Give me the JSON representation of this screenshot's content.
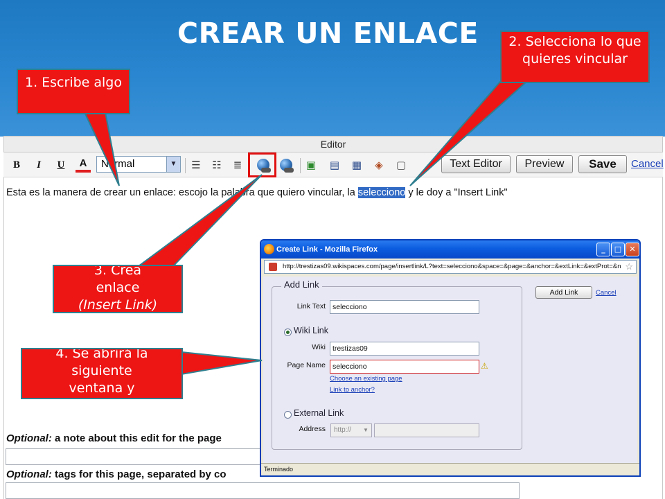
{
  "slide": {
    "title": "CREAR UN ENLACE"
  },
  "callouts": {
    "c1": "1. Escribe algo",
    "c2": "2. Selecciona lo que quieres vincular",
    "c3_line1": "3. Crea",
    "c3_line2": "enlace",
    "c3_line3": "(Insert Link)",
    "c4_line1": "4. Se abrirá la",
    "c4_line2": "siguiente",
    "c4_line3": "ventana y"
  },
  "editor": {
    "title": "Editor",
    "bold_label": "B",
    "italic_label": "I",
    "underline_label": "U",
    "color_label": "A",
    "format_value": "Normal",
    "text_editor_label": "Text Editor",
    "preview_label": "Preview",
    "save_label": "Save",
    "cancel_label": "Cancel",
    "body_before": "Esta es la manera de crear un enlace: escojo la palabra que quiero vincular, la ",
    "body_selected": "selecciono",
    "body_after": " y le doy a \"Insert Link\"",
    "optional_1_em": "Optional:",
    "optional_1_rest": " a note about this edit for the page",
    "optional_2_em": "Optional:",
    "optional_2_rest": " tags for this page, separated by co"
  },
  "popup": {
    "window_title": "Create Link - Mozilla Firefox",
    "url": "http://trestizas09.wikispaces.com/page/insertlink/L?text=selecciono&space=&page=&anchor=&extLink=&extProt=&n",
    "legend": "Add Link",
    "link_text_label": "Link Text",
    "link_text_value": "selecciono",
    "wiki_link_label": "Wiki Link",
    "wiki_label": "Wiki",
    "wiki_value": "trestizas09",
    "page_name_label": "Page Name",
    "page_name_value": "selecciono",
    "choose_page_link": "Choose an existing page",
    "anchor_link": "Link to anchor?",
    "external_link_label": "External Link",
    "address_label": "Address",
    "protocol_value": "http://",
    "add_link_button": "Add Link",
    "cancel_link": "Cancel",
    "status_text": "Terminado"
  }
}
